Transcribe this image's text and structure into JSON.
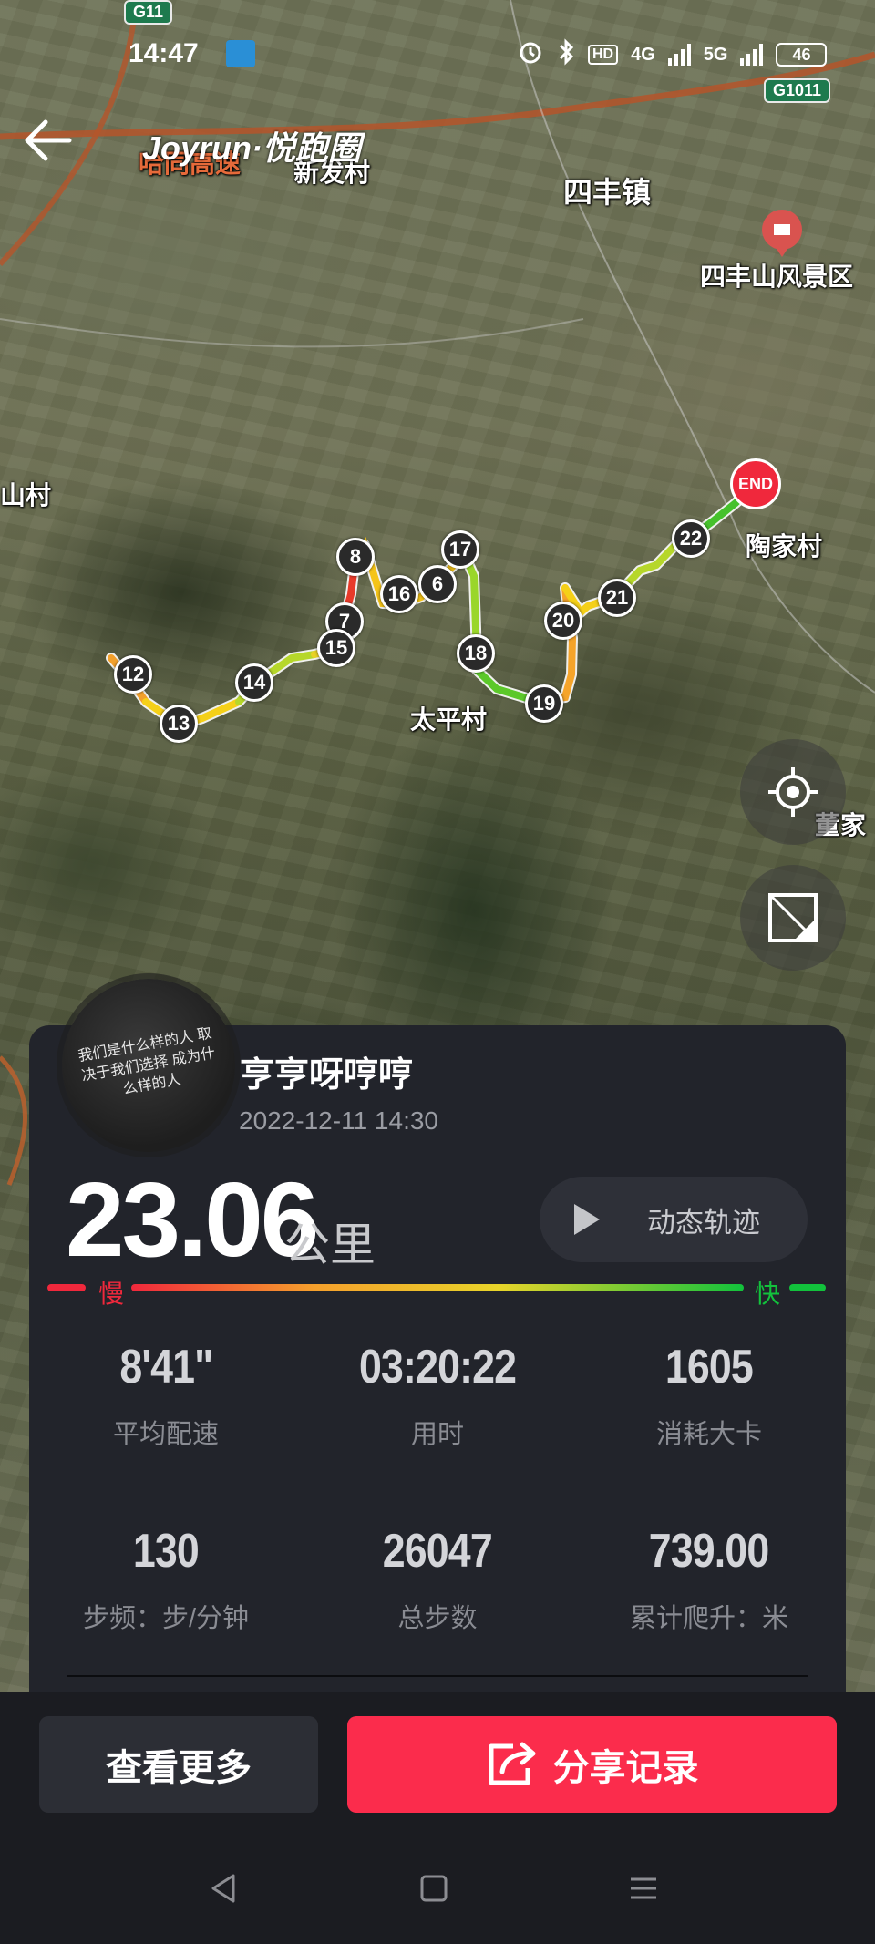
{
  "status_bar": {
    "time": "14:47",
    "network_hd": "HD",
    "network_4g": "4G",
    "network_5g": "5G",
    "battery": "46"
  },
  "header": {
    "back_icon": "arrow-left-icon",
    "logo": "Joyrun·悦跑圈"
  },
  "map": {
    "labels": [
      "哈同高速",
      "新发村",
      "四丰镇",
      "四丰山风景区",
      "山村",
      "陶家村",
      "太平村",
      "董家"
    ],
    "highway_badges": [
      "G11",
      "G1011"
    ],
    "km_markers": [
      "8",
      "16",
      "6",
      "17",
      "7",
      "15",
      "12",
      "14",
      "13",
      "18",
      "19",
      "20",
      "21",
      "22"
    ],
    "end_label": "END",
    "route_colors": {
      "slow": "#f0283c",
      "mid": "#f5c518",
      "fast": "#12c23c"
    }
  },
  "avatar": {
    "caption": "我们是什么样的人 取决于我们选择 成为什么样的人"
  },
  "run": {
    "user_name": "亨亨呀哼哼",
    "datetime": "2022-12-11 14:30",
    "distance": "23.06",
    "distance_unit": "公里",
    "replay_label": "动态轨迹",
    "pace_slow": "慢",
    "pace_fast": "快"
  },
  "stats": [
    {
      "value": "8'41\"",
      "label": "平均配速"
    },
    {
      "value": "03:20:22",
      "label": "用时"
    },
    {
      "value": "1605",
      "label": "消耗大卡"
    },
    {
      "value": "130",
      "label": "步频：步/分钟"
    },
    {
      "value": "26047",
      "label": "总步数"
    },
    {
      "value": "739.00",
      "label": "累计爬升：米"
    }
  ],
  "actions": {
    "more_label": "查看更多",
    "share_label": "分享记录"
  }
}
